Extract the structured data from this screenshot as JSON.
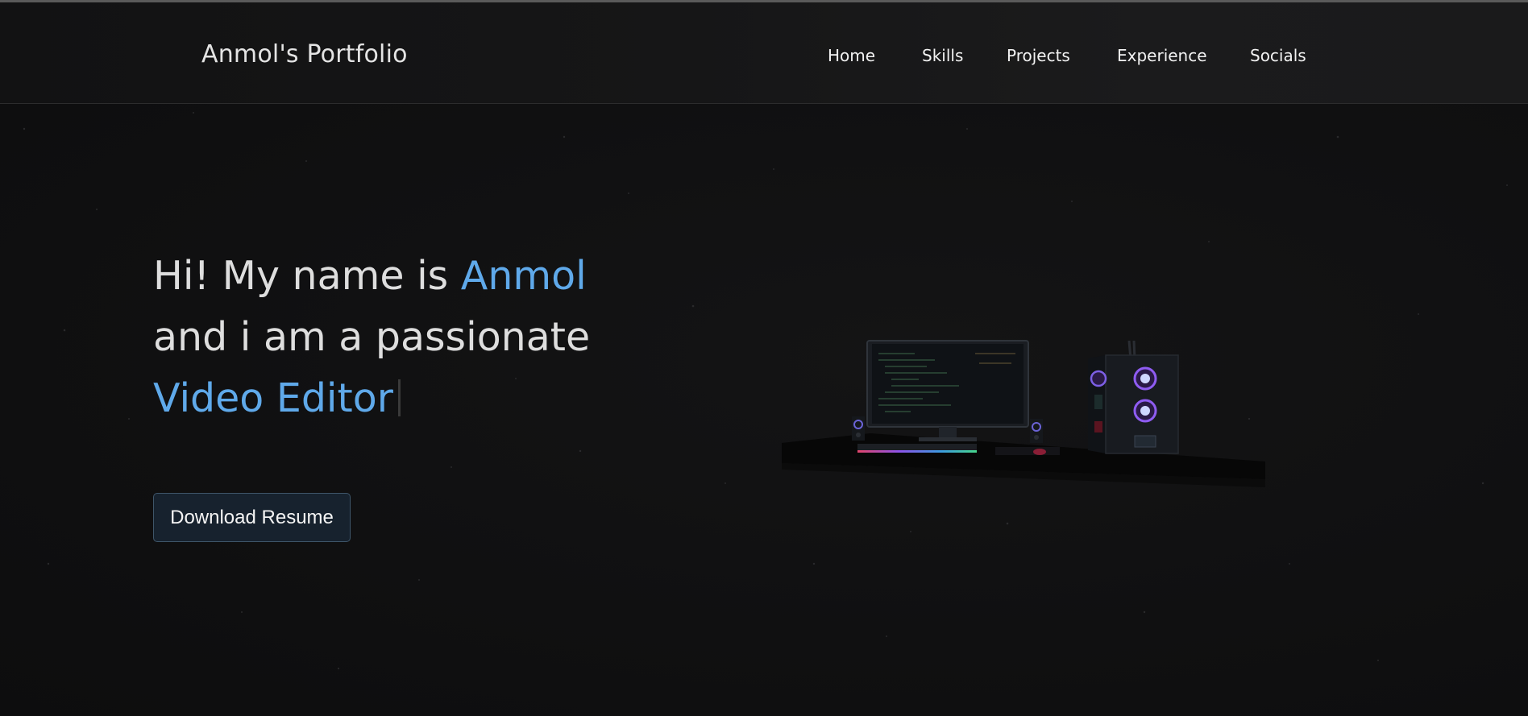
{
  "navbar": {
    "brand": "Anmol's Portfolio",
    "links": [
      {
        "label": "Home"
      },
      {
        "label": "Skills"
      },
      {
        "label": "Projects"
      },
      {
        "label": "Experience"
      },
      {
        "label": "Socials"
      }
    ]
  },
  "hero": {
    "line1_prefix": "Hi! My name is ",
    "name": "Anmol",
    "line2": "and i am a passionate",
    "role": "Video Editor",
    "download_button": "Download Resume"
  },
  "colors": {
    "background": "#101011",
    "accent": "#5fa9ea",
    "text": "#dedede",
    "button_bg": "#17222e",
    "button_border": "#3e5569"
  },
  "scene": {
    "icons": [
      "desk-setup-illustration",
      "monitor-icon",
      "pc-case-icon",
      "speaker-icon",
      "keyboard-icon"
    ]
  }
}
